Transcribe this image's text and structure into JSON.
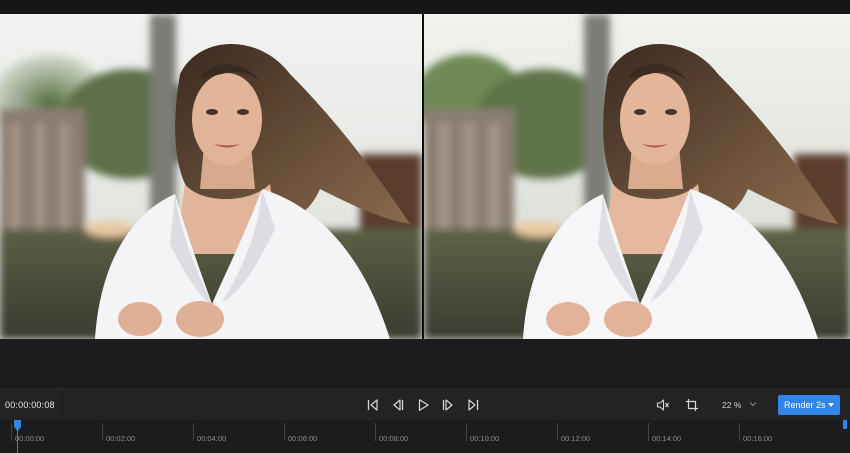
{
  "player": {
    "timecode": "00:00:00:08",
    "zoom": "22 %",
    "render_label": "Render 2s"
  },
  "controls": {
    "icons": [
      "skip-to-start-icon",
      "step-back-icon",
      "play-icon",
      "step-forward-icon",
      "skip-to-end-icon",
      "mute-icon",
      "crop-icon"
    ]
  },
  "timeline": {
    "labels": [
      "00:00:00",
      "00:02:00",
      "00:04:00",
      "00:06:00",
      "00:08:00",
      "00:10:00",
      "00:12:00",
      "00:14:00",
      "00:16:00"
    ]
  },
  "colors": {
    "accent": "#2f86e8",
    "background": "#1c1c1e",
    "toolbar": "#232325"
  }
}
